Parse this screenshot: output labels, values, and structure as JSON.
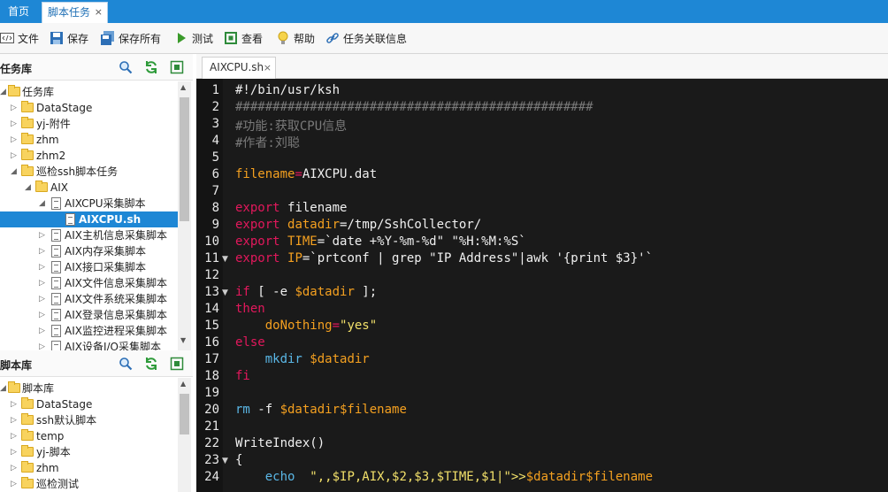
{
  "tabs": {
    "home": "首页",
    "active": "脚本任务",
    "close": "×"
  },
  "toolbar": {
    "file": "文件",
    "save": "保存",
    "save_all": "保存所有",
    "test": "测试",
    "view": "查看",
    "help": "帮助",
    "task_info": "任务关联信息"
  },
  "task_panel": {
    "title": "任务库",
    "items": [
      "任务库",
      "DataStage",
      "yj-附件",
      "zhm",
      "zhm2",
      "巡检ssh脚本任务",
      "AIX",
      "AIXCPU采集脚本",
      "AIXCPU.sh",
      "AIX主机信息采集脚本",
      "AIX内存采集脚本",
      "AIX接口采集脚本",
      "AIX文件信息采集脚本",
      "AIX文件系统采集脚本",
      "AIX登录信息采集脚本",
      "AIX监控进程采集脚本",
      "AIX设备I/O采集脚本"
    ]
  },
  "script_panel": {
    "title": "脚本库",
    "items": [
      "脚本库",
      "DataStage",
      "ssh默认脚本",
      "temp",
      "yj-脚本",
      "zhm",
      "巡检测试"
    ]
  },
  "editor": {
    "tab_label": "AIXCPU.sh",
    "tab_close": "×",
    "line_numbers": [
      "1",
      "2",
      "3",
      "4",
      "5",
      "6",
      "7",
      "8",
      "9",
      "10",
      "11",
      "12",
      "13",
      "14",
      "15",
      "16",
      "17",
      "18",
      "19",
      "20",
      "21",
      "22",
      "23",
      "24"
    ],
    "code": {
      "l1": "#!/bin/usr/ksh",
      "l2": "################################################",
      "l3": "#功能:获取CPU信息",
      "l4": "#作者:刘聪",
      "l6a": "filename",
      "l6b": "=",
      "l6c": "AIXCPU.dat",
      "export": "export",
      "l8b": "filename",
      "l9b": "datadir",
      "l9c": "=/tmp/SshCollector/",
      "l10b": "TIME",
      "l10c": "=`date +%Y-%m-%d\" \"%H:%M:%S`",
      "l11b": "IP",
      "l11c": "=`prtconf | grep \"IP Address\"|awk '{print $3}'`",
      "if": "if",
      "l13b": " [ -e ",
      "l13c": "$datadir",
      "l13d": " ];",
      "then": "then",
      "l15a": "doNothing",
      "l15b": "=",
      "l15c": "\"yes\"",
      "else": "else",
      "mkdir": "mkdir",
      "l17b": " $datadir",
      "fi": "fi",
      "rm": "rm",
      "l20b": " -f ",
      "l20c": "$datadir$filename",
      "l22": "WriteIndex()",
      "l23": "{",
      "echo": "echo",
      "l24b": "  \",,$IP,AIX,$2,$3,$TIME,$1|\">>",
      "l24c": "$datadir$filename"
    }
  }
}
